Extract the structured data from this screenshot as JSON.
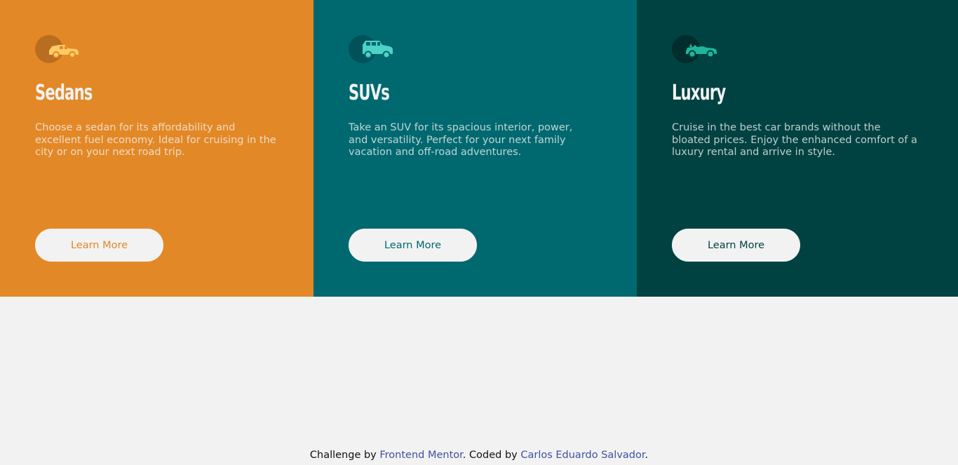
{
  "cards": [
    {
      "icon": "sedan-icon",
      "title": "Sedans",
      "description": "Choose a sedan for its affordability and excellent fuel economy. Ideal for cruising in the city or on your next road trip.",
      "button_label": "Learn More",
      "background_color": "#e38826"
    },
    {
      "icon": "suv-icon",
      "title": "SUVs",
      "description": "Take an SUV for its spacious interior, power, and versatility. Perfect for your next family vacation and off-road adventures.",
      "button_label": "Learn More",
      "background_color": "#006970"
    },
    {
      "icon": "luxury-car-icon",
      "title": "Luxury",
      "description": "Cruise in the best car brands without the bloated prices. Enjoy the enhanced comfort of a luxury rental and arrive in style.",
      "button_label": "Learn More",
      "background_color": "#004241"
    }
  ],
  "footer": {
    "prefix": "Challenge by ",
    "challenge_link": "Frontend Mentor",
    "middle": ". Coded by ",
    "author_link": "Carlos Eduardo Salvador",
    "suffix": "."
  },
  "colors": {
    "page_background": "#f2f2f2",
    "button_background": "#f2f2f2",
    "link_color": "#3e52a3"
  }
}
